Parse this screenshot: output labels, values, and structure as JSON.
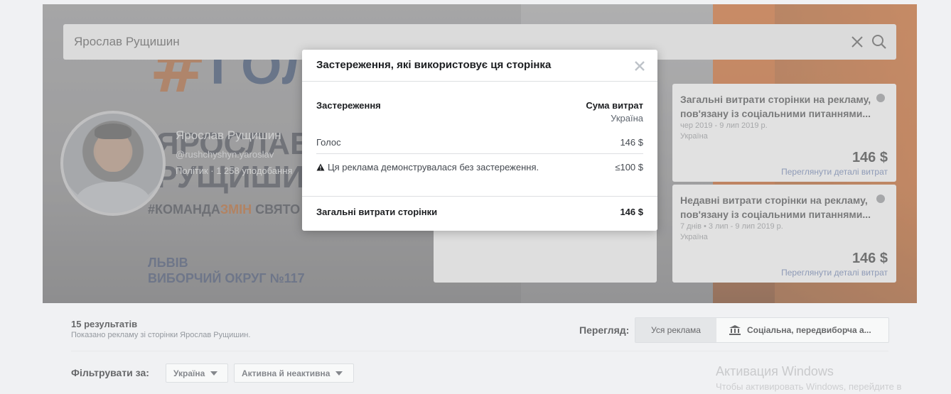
{
  "search": {
    "value": "Ярослав Рущишин"
  },
  "cover": {
    "logo_word": "ГОЛОС",
    "big_name_line1": "ЯРОСЛАВ",
    "big_name_line2": "РУЩИШИН",
    "hashtag_part1": "#КОМАНДА",
    "hashtag_part2": "ЗМІН",
    "hashtag_part3": " СВЯТО",
    "city": "ЛЬВІВ",
    "district": "ВИБОРЧИЙ ОКРУГ №117"
  },
  "profile": {
    "name": "Ярослав Рущишин",
    "handle": "@rushchyshyn.yaroslav",
    "meta": "Політик · 1 258 уподобання"
  },
  "side_cards": [
    {
      "title": "Загальні витрати сторінки на рекламу, пов'язану із соціальними питаннями...",
      "dates": "чер 2019 - 9 лип 2019 р.",
      "country": "Україна",
      "amount": "146 $",
      "link": "Переглянути деталі витрат"
    },
    {
      "title": "Недавні витрати сторінки на рекламу, пов'язану із соціальними питаннями...",
      "dates": "7 днів • 3 лип - 9 лип 2019 р.",
      "country": "Україна",
      "amount": "146 $",
      "link": "Переглянути деталі витрат"
    }
  ],
  "results": {
    "count": "15 результатів",
    "subtitle": "Показано рекламу зі сторінки Ярослав Рущишин.",
    "view_label": "Перегляд:",
    "view_all": "Уся реклама",
    "view_social": "Соціальна, передвиборча а...",
    "filter_label": "Фільтрувати за:",
    "filter_country": "Україна",
    "filter_status": "Активна й неактивна"
  },
  "watermark": {
    "line1": "Активация Windows",
    "line2": "Чтобы активировать Windows, перейдите в"
  },
  "modal": {
    "title": "Застереження, які використовує ця сторінка",
    "col_left": "Застереження",
    "col_right": "Сума витрат",
    "col_right_sub": "Україна",
    "rows": [
      {
        "name": "Голос",
        "amount": "146 $"
      },
      {
        "name": "Ця реклама демонструвалася без застереження.",
        "amount": "≤100 $"
      }
    ],
    "total_label": "Загальні витрати сторінки",
    "total_amount": "146 $"
  },
  "icons": {
    "clear": "close-icon",
    "search": "search-icon",
    "modal_close": "close-icon",
    "warning": "warning-icon",
    "info": "info-icon",
    "bank": "bank-icon"
  }
}
